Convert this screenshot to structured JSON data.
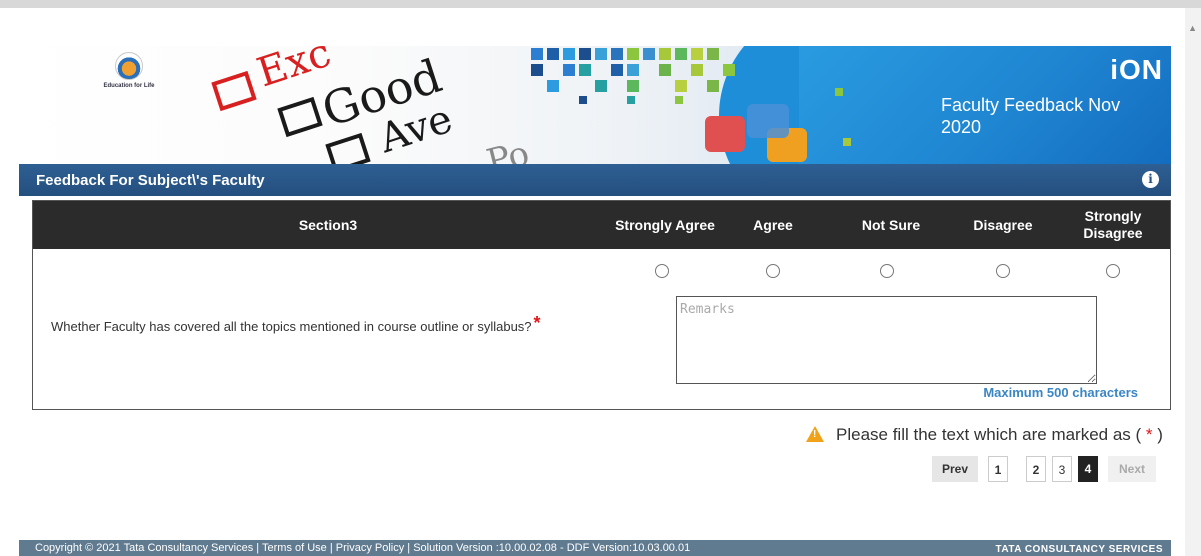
{
  "banner": {
    "logo_text": "Education for Life",
    "brand": "iON",
    "title": "Faculty Feedback Nov 2020",
    "photo_words": [
      "Exc",
      "Good",
      "Ave",
      "Po"
    ]
  },
  "form": {
    "title": "Feedback For Subject\\'s Faculty",
    "info_icon": "info-icon",
    "section_header": "Section3",
    "columns": [
      "Strongly Agree",
      "Agree",
      "Not Sure",
      "Disagree",
      "Strongly Disagree"
    ],
    "question": "Whether Faculty has covered all the topics mentioned in course outline or syllabus?",
    "required_mark": "*",
    "remarks_placeholder": "Remarks",
    "remarks_value": "",
    "max_chars": "Maximum 500 characters"
  },
  "warning": {
    "text": "Please fill the text which are marked as (",
    "star": "*",
    "close": ")"
  },
  "pagination": {
    "prev": "Prev",
    "pages": [
      "1",
      "2",
      "3",
      "4"
    ],
    "current": "4",
    "next": "Next"
  },
  "footer": {
    "copyright": "Copyright © 2021 Tata Consultancy Services | Terms of Use | Privacy Policy | Solution Version :10.00.02.08 - DDF Version:10.03.00.01",
    "brand": "TATA CONSULTANCY SERVICES"
  },
  "colors": {
    "title_bar": "#244f7f",
    "table_header": "#2b2b2b",
    "required": "#e01515",
    "link": "#3a86c4",
    "footer": "#607a8f"
  }
}
